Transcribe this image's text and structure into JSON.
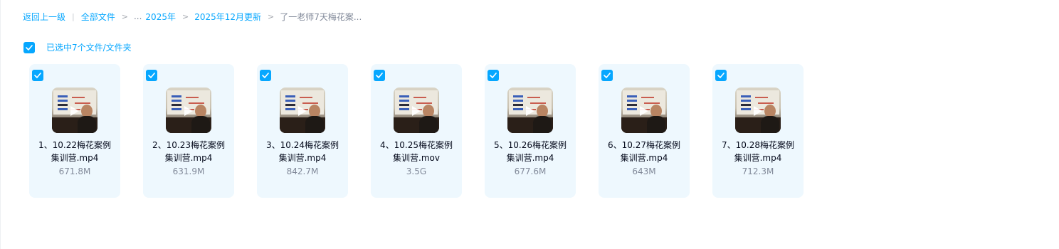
{
  "breadcrumb": {
    "back_label": "返回上一级",
    "root_label": "全部文件",
    "ellipsis": "...",
    "folder_2025": "2025年",
    "folder_dec": "2025年12月更新",
    "current": "了一老师7天梅花案..."
  },
  "selection": {
    "label": "已选中7个文件/文件夹",
    "all_checked": true
  },
  "files": [
    {
      "line1": "1、10.22梅花案例",
      "line2": "集训营.mp4",
      "size": "671.8M",
      "checked": true,
      "icon": "video-thumbnail"
    },
    {
      "line1": "2、10.23梅花案例",
      "line2": "集训营.mp4",
      "size": "631.9M",
      "checked": true,
      "icon": "video-thumbnail"
    },
    {
      "line1": "3、10.24梅花案例",
      "line2": "集训营.mp4",
      "size": "842.7M",
      "checked": true,
      "icon": "video-thumbnail"
    },
    {
      "line1": "4、10.25梅花案例",
      "line2": "集训营.mov",
      "size": "3.5G",
      "checked": true,
      "icon": "video-thumbnail"
    },
    {
      "line1": "5、10.26梅花案例",
      "line2": "集训营.mp4",
      "size": "677.6M",
      "checked": true,
      "icon": "video-thumbnail"
    },
    {
      "line1": "6、10.27梅花案例",
      "line2": "集训营.mp4",
      "size": "643M",
      "checked": true,
      "icon": "video-thumbnail"
    },
    {
      "line1": "7、10.28梅花案例",
      "line2": "集训营.mp4",
      "size": "712.3M",
      "checked": true,
      "icon": "video-thumbnail"
    }
  ],
  "colors": {
    "accent": "#06a7ff",
    "card_bg": "#eef8fe",
    "text": "#03081a",
    "muted": "#818999"
  }
}
